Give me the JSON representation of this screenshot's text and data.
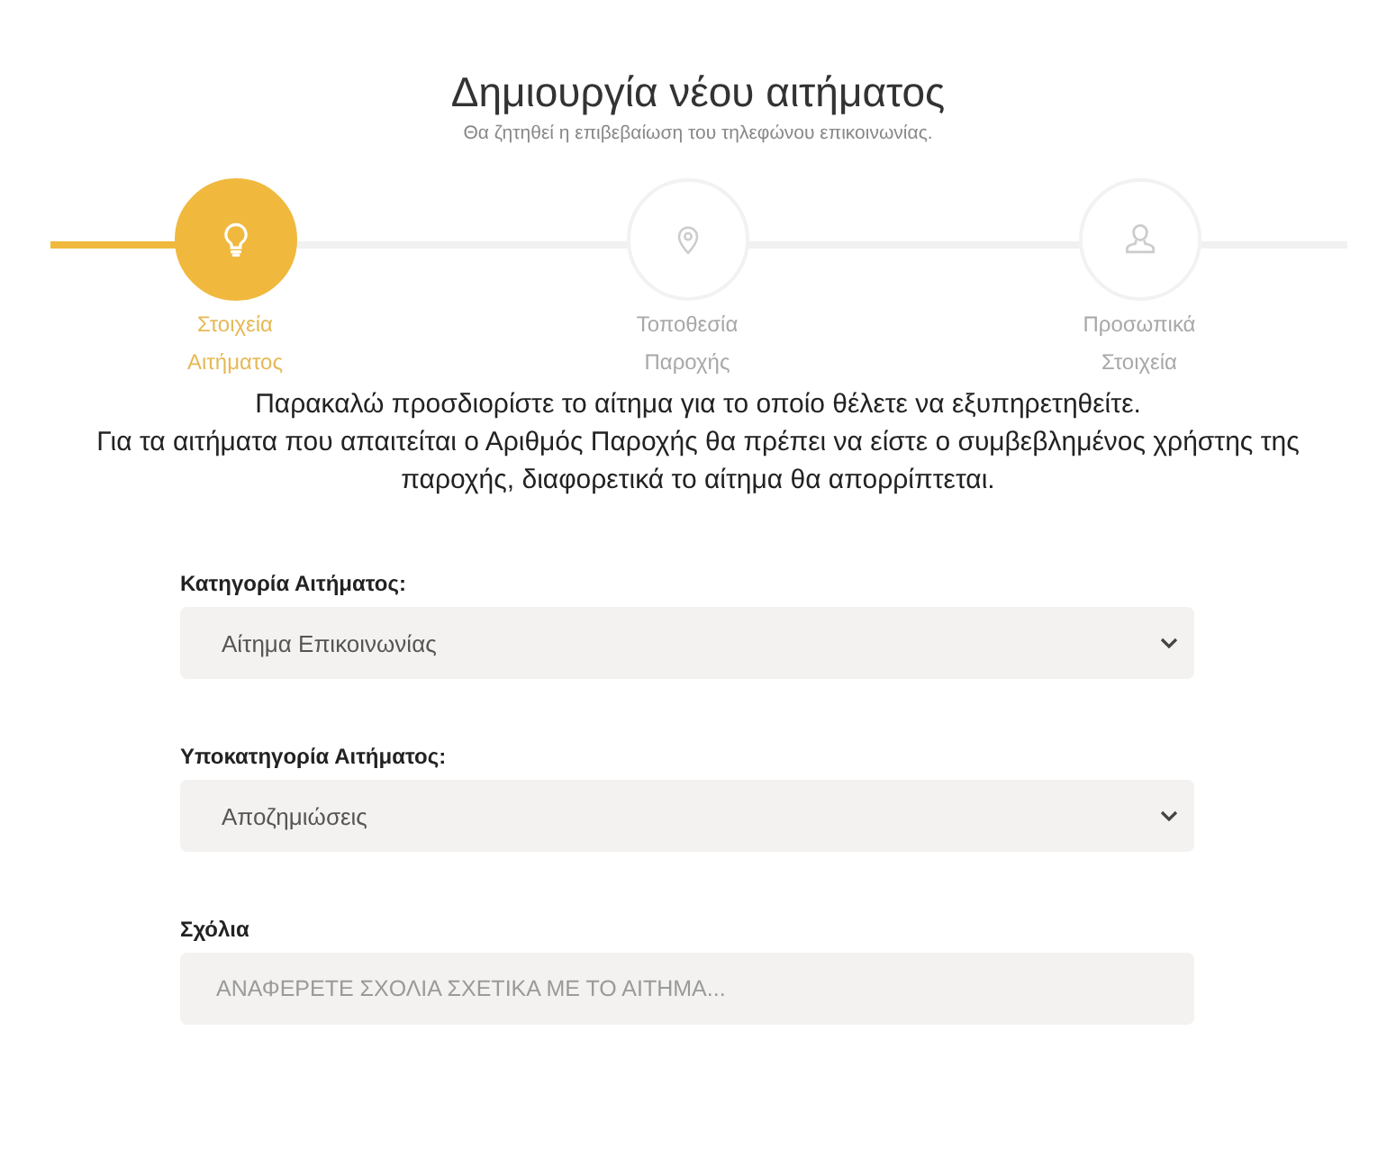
{
  "header": {
    "title": "Δημιουργία νέου αιτήματος",
    "subtitle": "Θα ζητηθεί η επιβεβαίωση του τηλεφώνου επικοινωνίας."
  },
  "steps": [
    {
      "label": "Στοιχεία Αιτήματος",
      "selected": true
    },
    {
      "label": "Τοποθεσία Παροχής",
      "selected": false
    },
    {
      "label": "Προσωπικά Στοιχεία",
      "selected": false
    }
  ],
  "instructions": [
    "Παρακαλώ προσδιορίστε το αίτημα για το οποίο θέλετε να εξυπηρετηθείτε.",
    "Για τα αιτήματα που απαιτείται ο Αριθμός Παροχής θα πρέπει να είστε ο συμβεβλημένος χρήστης της παροχής, διαφορετικά το αίτημα θα απορρίπτεται."
  ],
  "form": [
    {
      "kind": "dropdown",
      "label": "Κατηγορία Αιτήματος:",
      "value": "Αίτημα Επικοινωνίας"
    },
    {
      "kind": "dropdown",
      "label": "Υποκατηγορία Αιτήματος:",
      "value": "Αποζημιώσεις"
    },
    {
      "kind": "text",
      "label": "Σχόλια",
      "placeholder": "ΑΝΑΦΕΡΕΤΕ ΣΧΟΛΙΑ ΣΧΕΤΙΚΑ ΜΕ ΤΟ ΑΙΤΗΜΑ..."
    }
  ]
}
